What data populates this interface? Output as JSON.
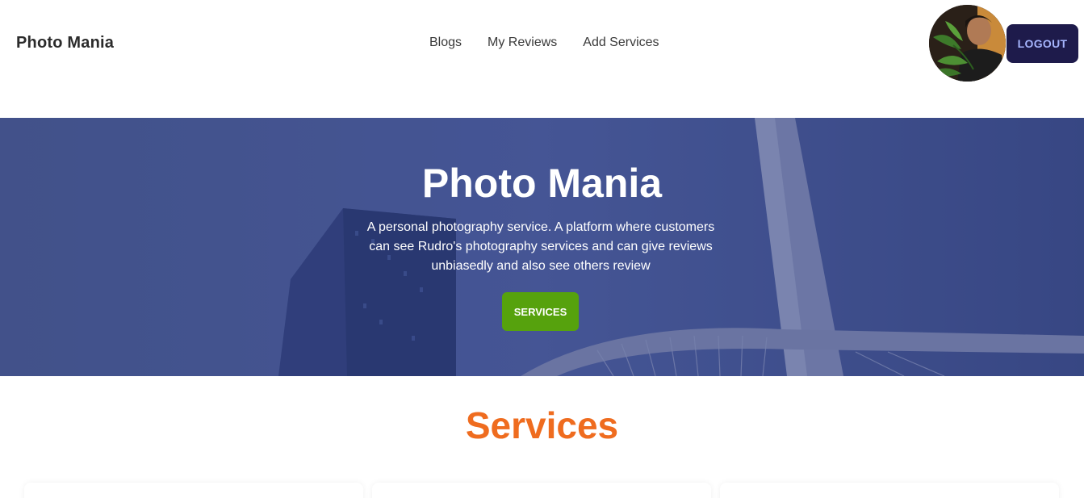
{
  "navbar": {
    "brand": "Photo Mania",
    "links": [
      "Blogs",
      "My Reviews",
      "Add Services"
    ],
    "logout_label": "LOGOUT",
    "avatar_icon": "user-avatar"
  },
  "hero": {
    "title": "Photo Mania",
    "description": "A personal photography service. A platform where customers can see Rudro's photography services and can give reviews unbiasedly and also see others review",
    "button_label": "SERVICES"
  },
  "services": {
    "title": "Services"
  },
  "colors": {
    "logout_bg": "#1e1b4b",
    "logout_text": "#a5b4fc",
    "services_button": "#56a20d",
    "section_title": "#ef6c1f",
    "hero_overlay": "#3f4f86"
  }
}
